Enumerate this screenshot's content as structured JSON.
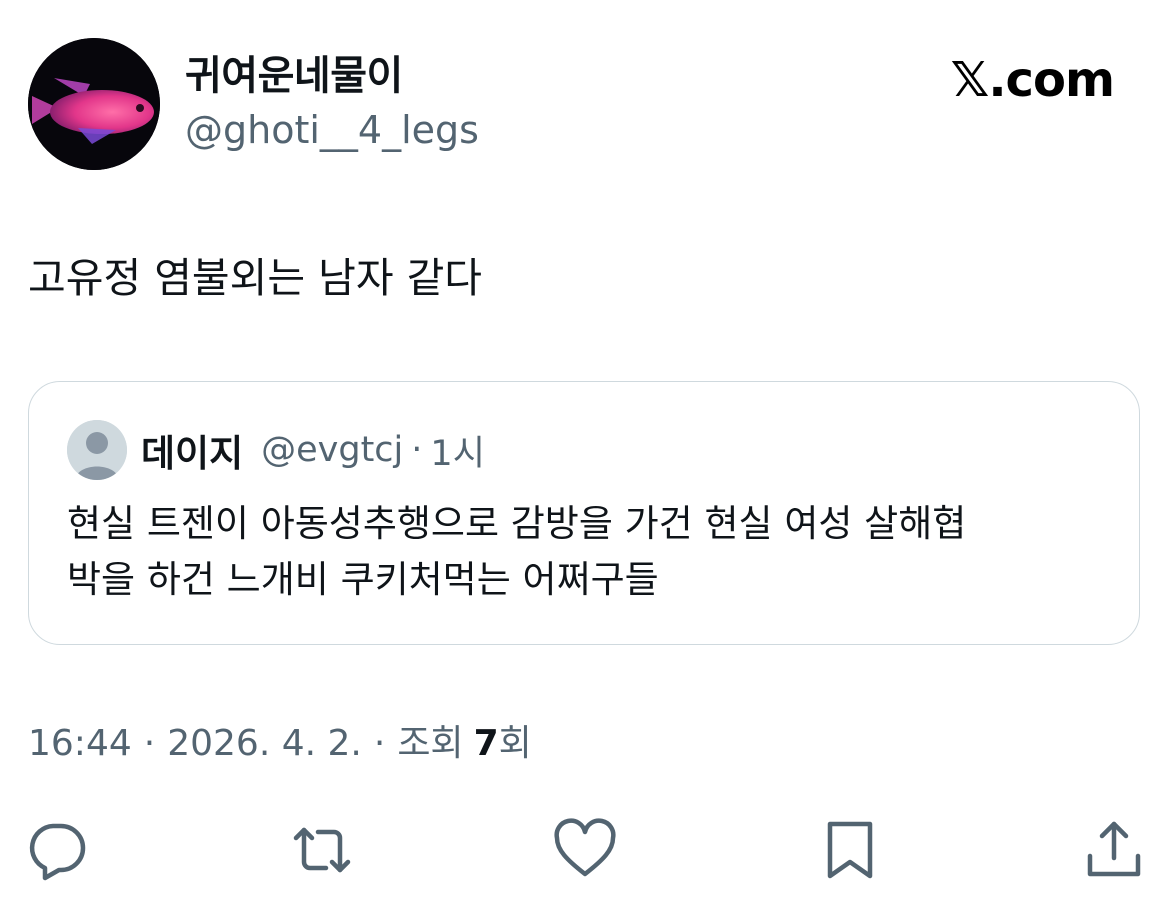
{
  "author": {
    "display_name": "귀여운네물이",
    "handle": "@ghoti__4_legs",
    "avatar_icon": "fish-avatar"
  },
  "brand": {
    "label": "𝕏.com"
  },
  "tweet": {
    "text": "고유정 염불외는 남자 같다"
  },
  "quoted_tweet": {
    "author_name": "데이지",
    "author_handle": "@evgtcj",
    "separator": "·",
    "time": "1시",
    "text": "현실 트젠이 아동성추행으로 감방을 가건 현실 여성 살해협\n박을 하건 느개비 쿠키처먹는 어쩌구들"
  },
  "meta": {
    "time": "16:44",
    "sep1": "·",
    "date": "2026. 4. 2.",
    "sep2": "·",
    "views_label": "조회",
    "views_count": "7",
    "views_suffix": "회"
  },
  "actions": [
    "reply-icon",
    "retweet-icon",
    "like-icon",
    "bookmark-icon",
    "share-icon"
  ],
  "colors": {
    "text": "#0f1419",
    "muted": "#536471",
    "border": "#cfd9de"
  }
}
